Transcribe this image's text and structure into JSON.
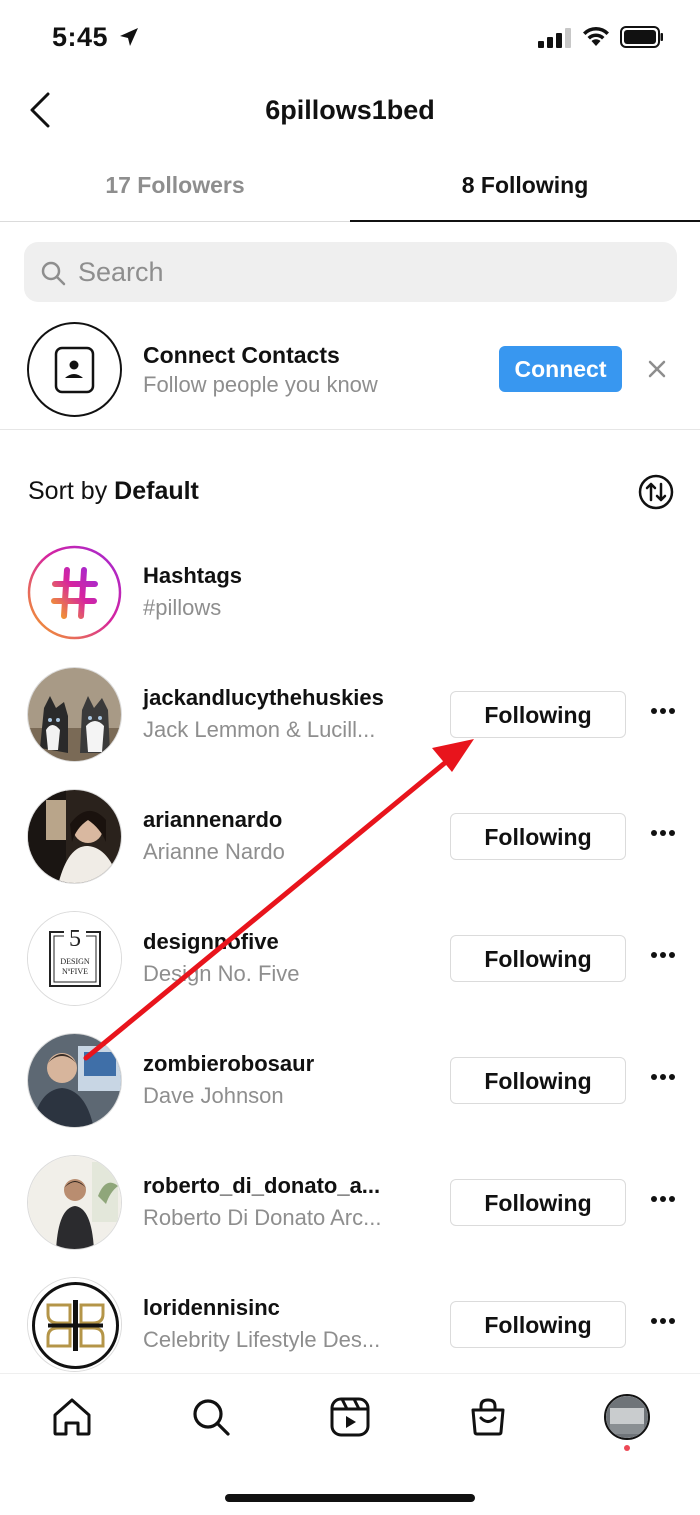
{
  "status_bar": {
    "time": "5:45"
  },
  "header": {
    "title": "6pillows1bed"
  },
  "tabs": [
    {
      "label": "17 Followers",
      "active": false
    },
    {
      "label": "8 Following",
      "active": true
    }
  ],
  "search": {
    "placeholder": "Search"
  },
  "contacts": {
    "title": "Connect Contacts",
    "subtitle": "Follow people you know",
    "button_label": "Connect"
  },
  "sort": {
    "prefix": "Sort by",
    "value": "Default"
  },
  "hashtags": {
    "title": "Hashtags",
    "subtitle": "#pillows"
  },
  "accounts": [
    {
      "username": "jackandlucythehuskies",
      "name": "Jack Lemmon & Lucill...",
      "button": "Following"
    },
    {
      "username": "ariannenardo",
      "name": "Arianne Nardo",
      "button": "Following"
    },
    {
      "username": "designnofive",
      "name": "Design No. Five",
      "button": "Following"
    },
    {
      "username": "zombierobosaur",
      "name": "Dave Johnson",
      "button": "Following"
    },
    {
      "username": "roberto_di_donato_a...",
      "name": "Roberto Di Donato Arc...",
      "button": "Following"
    },
    {
      "username": "loridennisinc",
      "name": "Celebrity Lifestyle Des...",
      "button": "Following"
    }
  ],
  "designnofive_logo": {
    "number": "5",
    "line1": "DESIGN",
    "line2": "NºFIVE"
  },
  "colors": {
    "accent": "#3897f0",
    "annotation_arrow": "#e8141c",
    "hashtag_gradient": [
      "#f5a623",
      "#d6249f",
      "#285aeb"
    ]
  },
  "bottom_nav": [
    "home-icon",
    "search-icon",
    "reels-icon",
    "shop-icon",
    "profile-avatar"
  ]
}
